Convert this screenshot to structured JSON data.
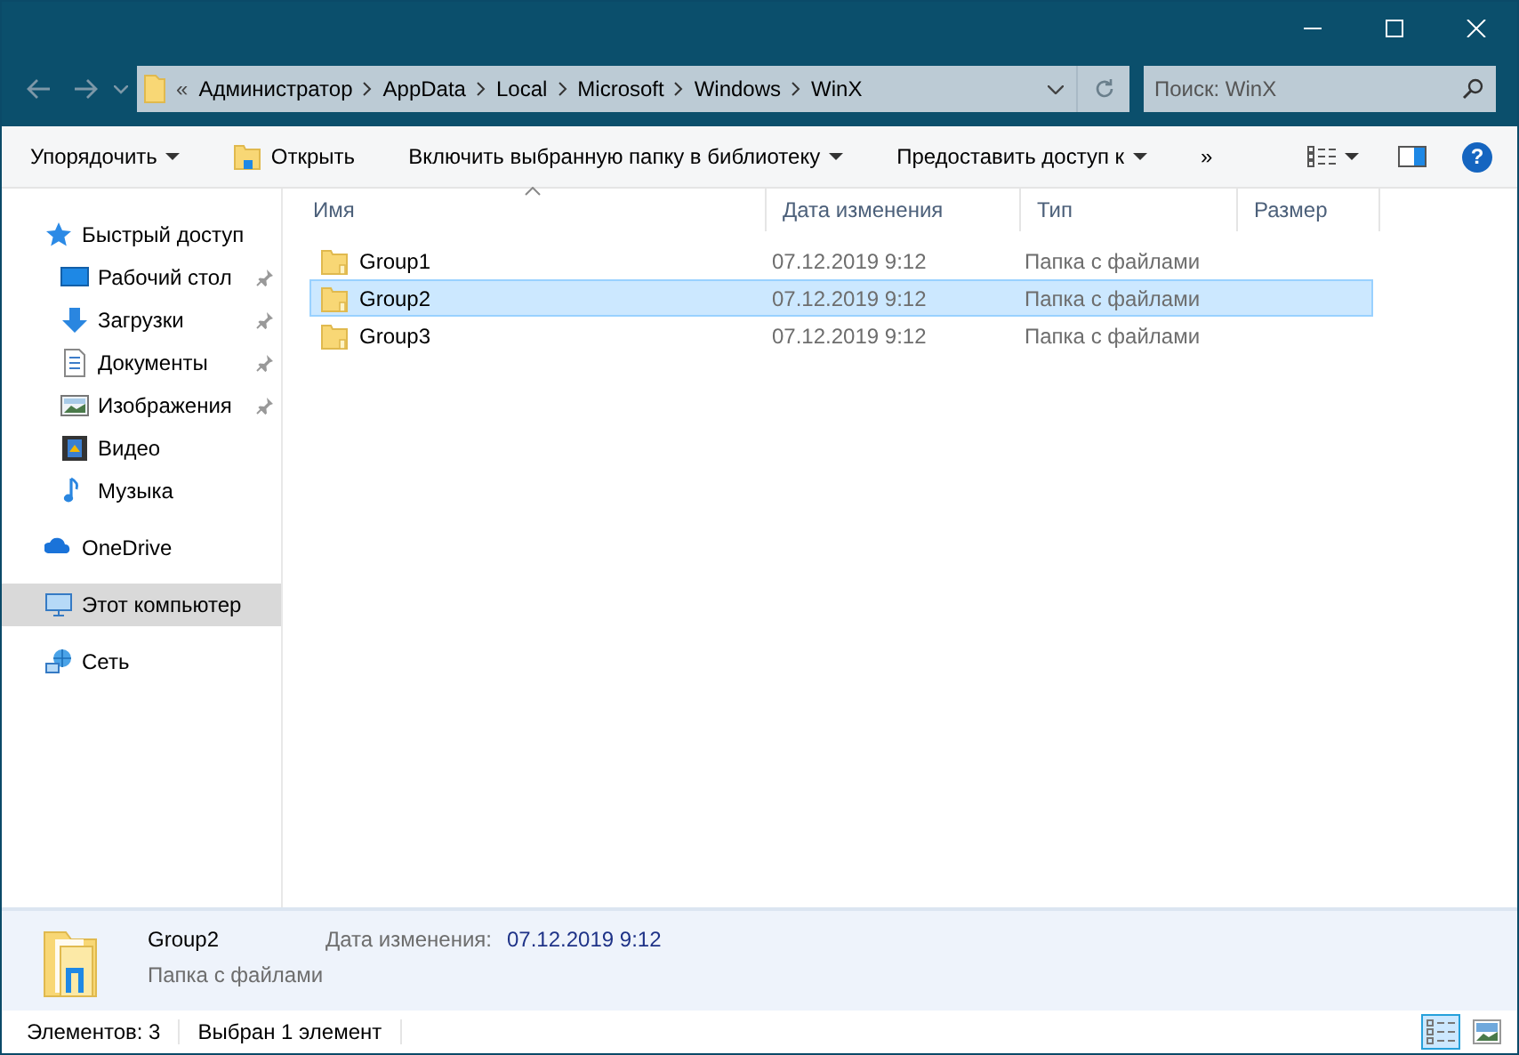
{
  "address": {
    "overflow": "«",
    "path": [
      "Администратор",
      "AppData",
      "Local",
      "Microsoft",
      "Windows",
      "WinX"
    ]
  },
  "search": {
    "placeholder": "Поиск: WinX"
  },
  "toolbar": [
    {
      "label": "Упорядочить",
      "dropdown": true,
      "icon": false
    },
    {
      "label": "Открыть",
      "dropdown": false,
      "icon": true
    },
    {
      "label": "Включить выбранную папку в библиотеку",
      "dropdown": true,
      "icon": false
    },
    {
      "label": "Предоставить доступ к",
      "dropdown": true,
      "icon": false
    },
    {
      "label": "»",
      "dropdown": false,
      "icon": false
    }
  ],
  "help": "?",
  "sidebar": {
    "items": [
      {
        "label": "Быстрый доступ",
        "selected": false,
        "children": [
          {
            "label": "Рабочий стол",
            "pinned": true,
            "selected": false
          },
          {
            "label": "Загрузки",
            "pinned": true,
            "selected": false
          },
          {
            "label": "Документы",
            "pinned": true,
            "selected": false
          },
          {
            "label": "Изображения",
            "pinned": true,
            "selected": false
          },
          {
            "label": "Видео",
            "pinned": false,
            "selected": false
          },
          {
            "label": "Музыка",
            "pinned": false,
            "selected": false
          }
        ]
      },
      {
        "label": "OneDrive",
        "selected": false
      },
      {
        "label": "Этот компьютер",
        "selected": true
      },
      {
        "label": "Сеть",
        "selected": false
      }
    ]
  },
  "table": {
    "columns": [
      {
        "label": "Имя",
        "sorted": true
      },
      {
        "label": "Дата изменения",
        "sorted": false
      },
      {
        "label": "Тип",
        "sorted": false
      },
      {
        "label": "Размер",
        "sorted": false
      }
    ],
    "rows": [
      {
        "name": "Group1",
        "date": "07.12.2019 9:12",
        "type": "Папка с файлами",
        "selected": false
      },
      {
        "name": "Group2",
        "date": "07.12.2019 9:12",
        "type": "Папка с файлами",
        "selected": true
      },
      {
        "name": "Group3",
        "date": "07.12.2019 9:12",
        "type": "Папка с файлами",
        "selected": false
      }
    ]
  },
  "details": {
    "name": "Group2",
    "type": "Папка с файлами",
    "label": "Дата изменения:",
    "value": "07.12.2019 9:12"
  },
  "status_bar": {
    "count": "Элементов: 3",
    "selection": "Выбран 1 элемент",
    "views": [
      {
        "kind": "details",
        "selected": true
      },
      {
        "kind": "thumbnails",
        "selected": false
      }
    ]
  }
}
